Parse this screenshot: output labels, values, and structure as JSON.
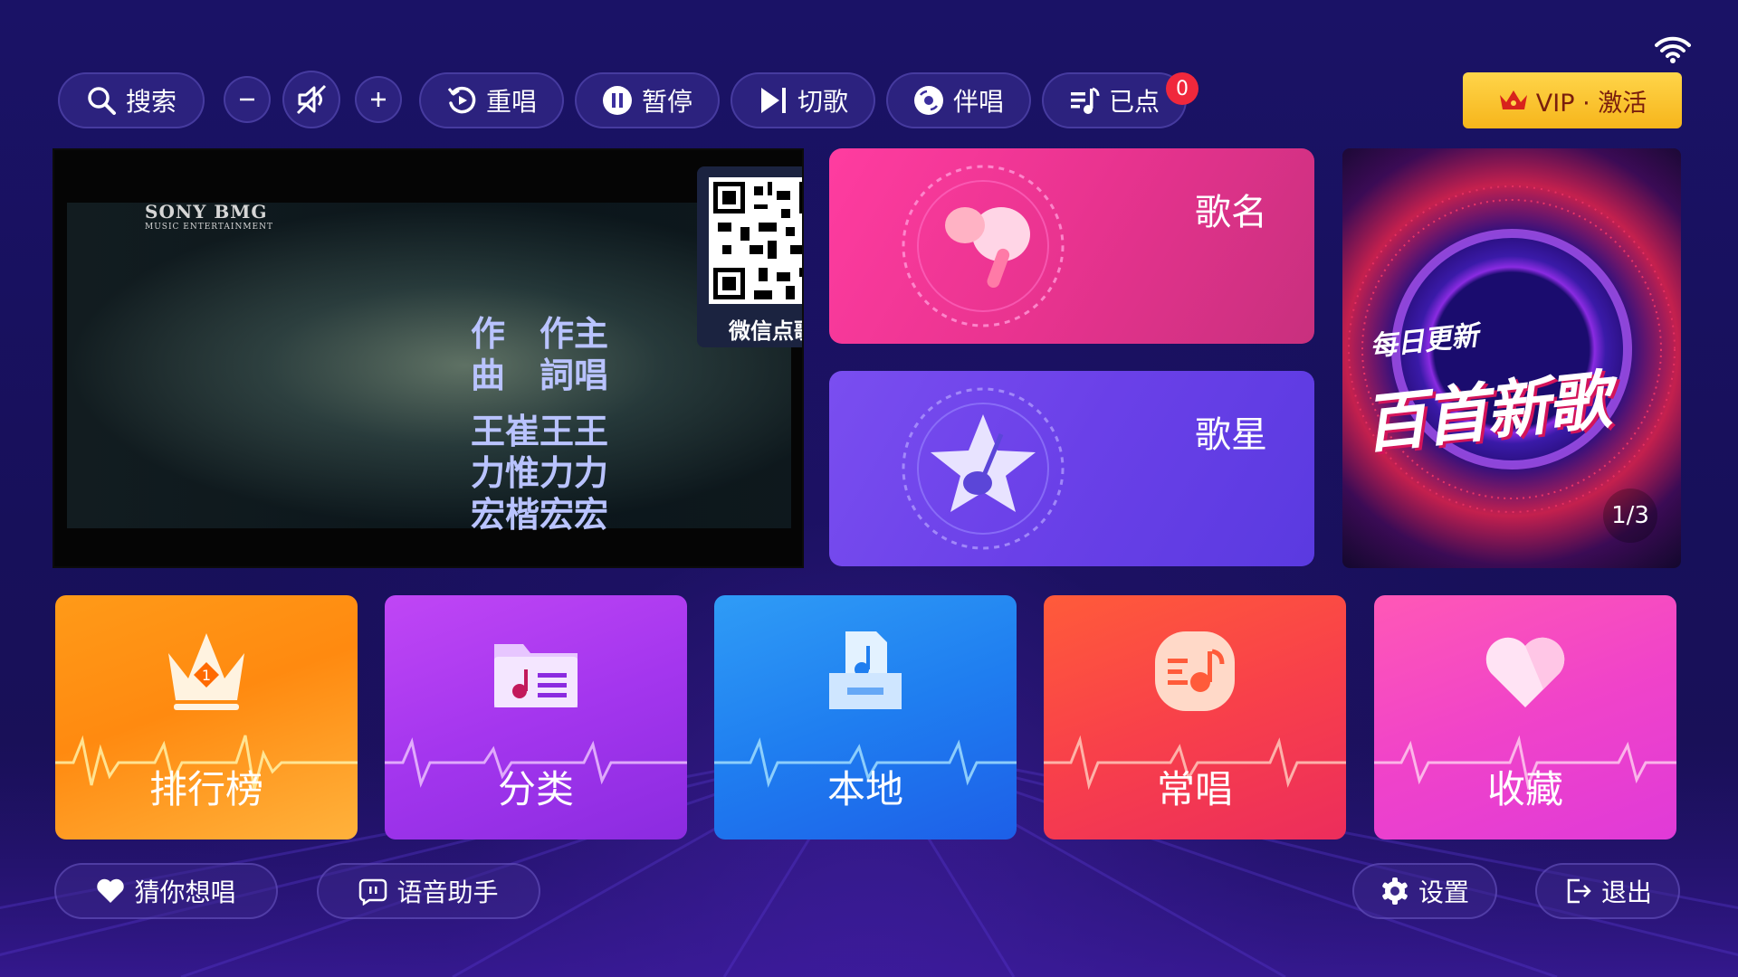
{
  "status": {
    "wifi_icon": "wifi-icon"
  },
  "toolbar": {
    "search_label": "搜索",
    "rewind_label": "重唱",
    "pause_label": "暂停",
    "skip_label": "切歌",
    "accompany_label": "伴唱",
    "queued_label": "已点",
    "queued_count": "0",
    "vip_label": "VIP · 激活"
  },
  "video": {
    "logo_line1": "SONY BMG",
    "logo_line2": "MUSIC ENTERTAINMENT",
    "credits_line1": "作　作主",
    "credits_line2": "曲　詞唱",
    "credits_line3": "王崔王王",
    "credits_line4": "力惟力力",
    "credits_line5": "宏楷宏宏",
    "qr_caption": "微信点歌"
  },
  "cards": {
    "song_name": "歌名",
    "singer": "歌星"
  },
  "banner": {
    "line1": "每日更新",
    "line2": "百首新歌",
    "pager": "1/3"
  },
  "tiles": [
    {
      "label": "排行榜",
      "color_from": "#ff8a10",
      "color_to": "#ffb235"
    },
    {
      "label": "分类",
      "color_from": "#b13bf0",
      "color_to": "#8a2be2"
    },
    {
      "label": "本地",
      "color_from": "#2f8ff5",
      "color_to": "#1d63e8"
    },
    {
      "label": "常唱",
      "color_from": "#ff5a3c",
      "color_to": "#ef2d5a"
    },
    {
      "label": "收藏",
      "color_from": "#ff4fb0",
      "color_to": "#e23bd8"
    }
  ],
  "bottom": {
    "guess_label": "猜你想唱",
    "voice_label": "语音助手",
    "settings_label": "设置",
    "exit_label": "退出"
  }
}
